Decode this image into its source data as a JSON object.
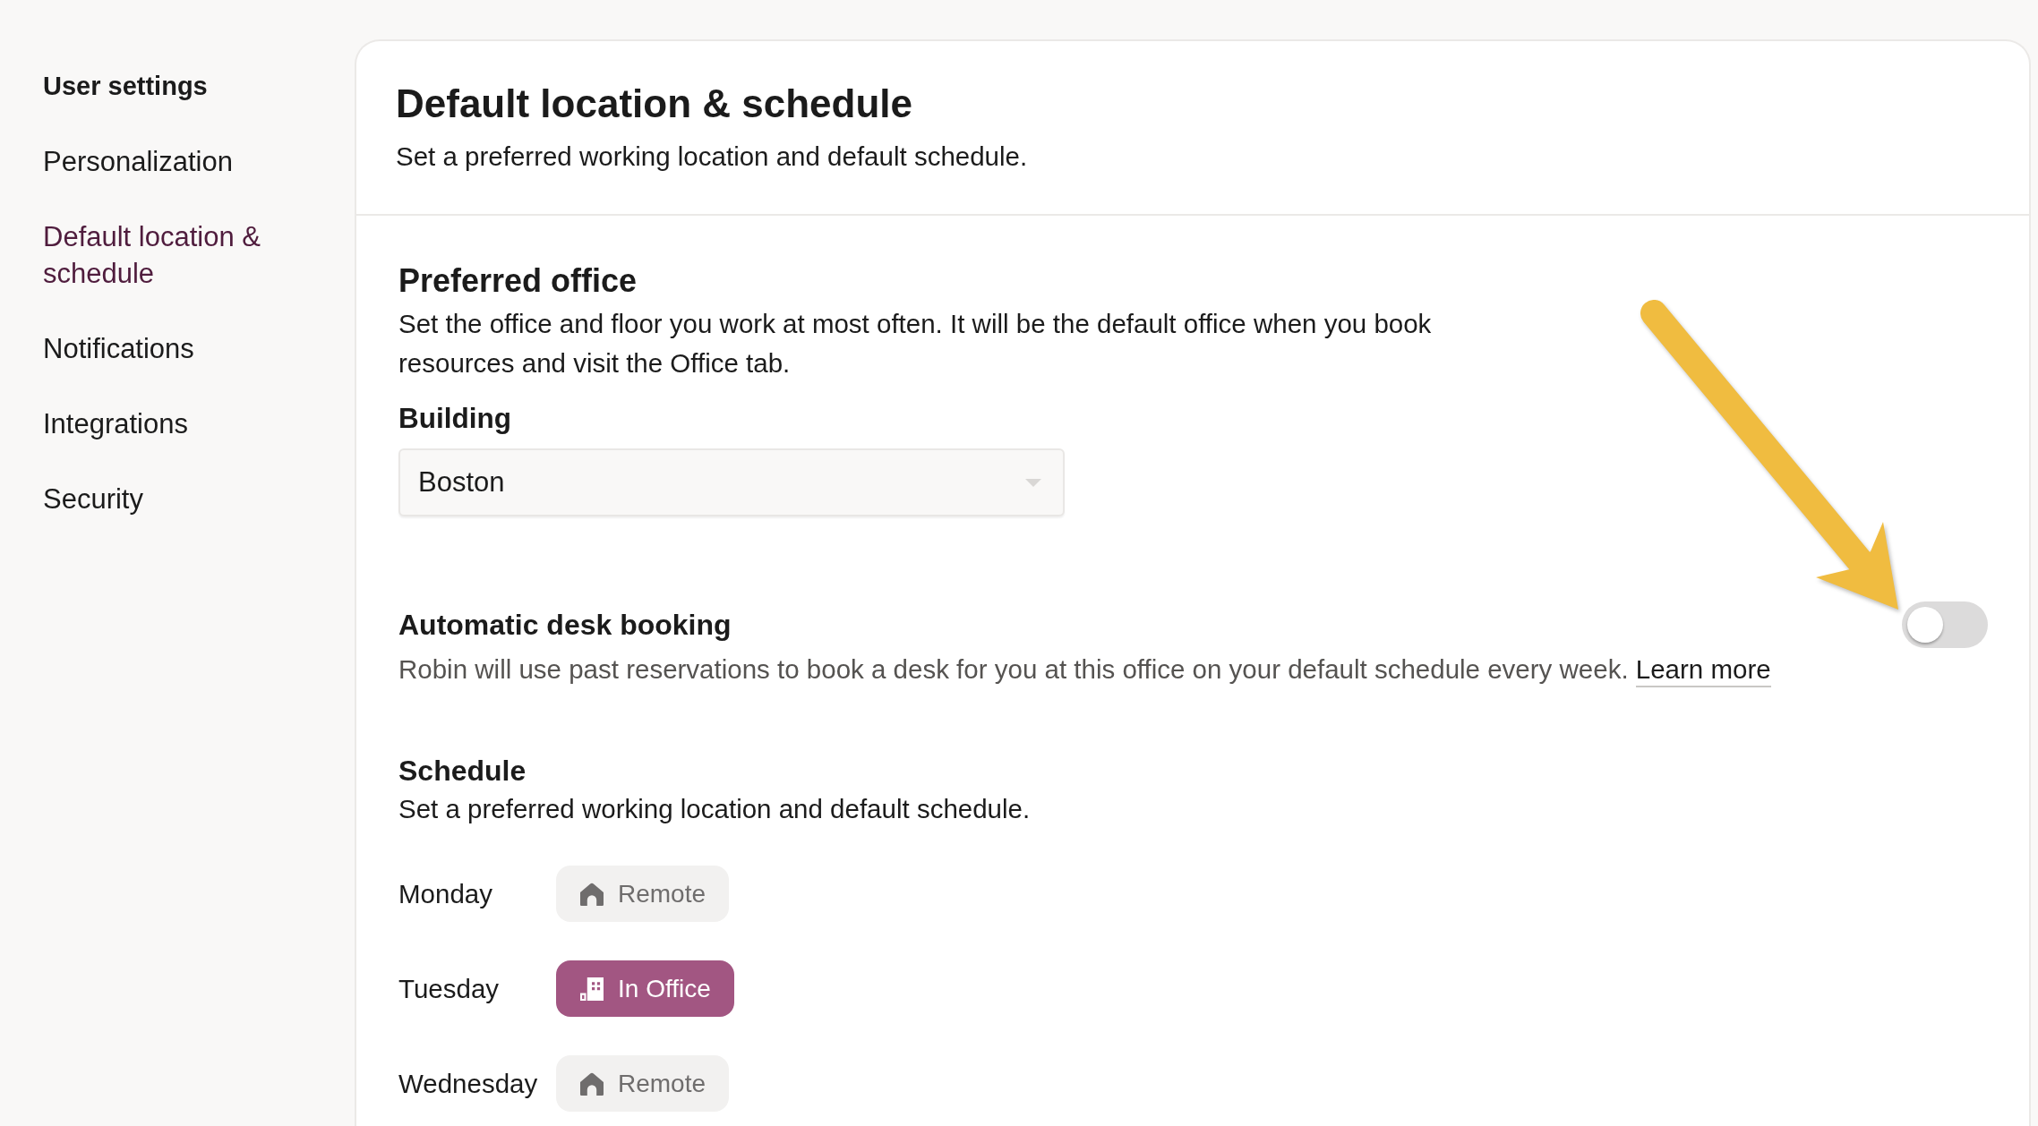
{
  "sidebar": {
    "heading": "User settings",
    "items": [
      {
        "label": "Personalization",
        "selected": false
      },
      {
        "label": "Default location & schedule",
        "selected": true
      },
      {
        "label": "Notifications",
        "selected": false
      },
      {
        "label": "Integrations",
        "selected": false
      },
      {
        "label": "Security",
        "selected": false
      }
    ]
  },
  "page": {
    "title": "Default location & schedule",
    "subtitle": "Set a preferred working location and default schedule."
  },
  "preferred_office": {
    "title": "Preferred office",
    "description": "Set the office and floor you work at most often. It will be the default office when you book resources and visit the Office tab.",
    "building": {
      "label": "Building",
      "value": "Boston"
    }
  },
  "automatic_desk_booking": {
    "title": "Automatic desk booking",
    "on": false,
    "description": "Robin will use past reservations to book a desk for you at this office on your default schedule every week.",
    "link": "Learn more"
  },
  "schedule": {
    "title": "Schedule",
    "description": "Set a preferred working location and default schedule.",
    "days": [
      {
        "day": "Monday",
        "kind": "remote",
        "label": "Remote"
      },
      {
        "day": "Tuesday",
        "kind": "office",
        "label": "In Office"
      },
      {
        "day": "Wednesday",
        "kind": "remote",
        "label": "Remote"
      }
    ]
  }
}
